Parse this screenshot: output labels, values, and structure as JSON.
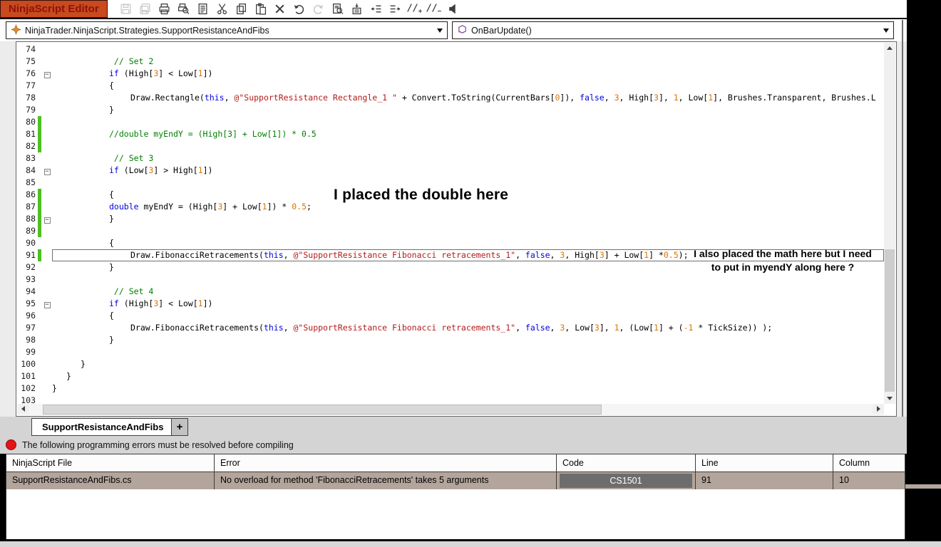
{
  "window": {
    "title": "NinjaScript Editor"
  },
  "toolbar": {
    "icons": [
      {
        "name": "save-icon",
        "disabled": true
      },
      {
        "name": "save-all-icon",
        "disabled": true
      },
      {
        "name": "print-icon",
        "disabled": false
      },
      {
        "name": "print-preview-icon",
        "disabled": false
      },
      {
        "name": "properties-icon",
        "disabled": false
      },
      {
        "name": "cut-icon",
        "disabled": false
      },
      {
        "name": "copy-icon",
        "disabled": false
      },
      {
        "name": "paste-icon",
        "disabled": false
      },
      {
        "name": "delete-icon",
        "disabled": false
      },
      {
        "name": "undo-icon",
        "disabled": false
      },
      {
        "name": "redo-icon",
        "disabled": true
      },
      {
        "name": "find-icon",
        "disabled": false
      },
      {
        "name": "code-snippet-icon",
        "disabled": false
      },
      {
        "name": "decrease-indent-icon",
        "disabled": false
      },
      {
        "name": "increase-indent-icon",
        "disabled": false
      },
      {
        "name": "add-comment-icon",
        "disabled": false
      },
      {
        "name": "remove-comment-icon",
        "disabled": false
      },
      {
        "name": "compile-icon",
        "disabled": false
      }
    ]
  },
  "navigation": {
    "class_selector": "NinjaTrader.NinjaScript.Strategies.SupportResistanceAndFibs",
    "method_selector": "OnBarUpdate()"
  },
  "editor": {
    "lines": [
      {
        "n": 74,
        "t": 0,
        "s": []
      },
      {
        "n": 75,
        "t": 4,
        "s": [
          [
            "c",
            " // Set 2"
          ]
        ]
      },
      {
        "n": 76,
        "t": 4,
        "f": true,
        "s": [
          [
            "k",
            "if"
          ],
          [
            "p",
            " (High["
          ],
          [
            "n",
            "3"
          ],
          [
            "p",
            "] < Low["
          ],
          [
            "n",
            "1"
          ],
          [
            "p",
            "])"
          ]
        ]
      },
      {
        "n": 77,
        "t": 4,
        "s": [
          [
            "p",
            "{"
          ]
        ]
      },
      {
        "n": 78,
        "t": 5.5,
        "s": [
          [
            "p",
            "Draw.Rectangle("
          ],
          [
            "k",
            "this"
          ],
          [
            "p",
            ", "
          ],
          [
            "s",
            "@\"SupportResistance Rectangle_1 \""
          ],
          [
            "p",
            " + Convert.ToString(CurrentBars["
          ],
          [
            "n",
            "0"
          ],
          [
            "p",
            "]), "
          ],
          [
            "k",
            "false"
          ],
          [
            "p",
            ", "
          ],
          [
            "n",
            "3"
          ],
          [
            "p",
            ", High["
          ],
          [
            "n",
            "3"
          ],
          [
            "p",
            "], "
          ],
          [
            "n",
            "1"
          ],
          [
            "p",
            ", Low["
          ],
          [
            "n",
            "1"
          ],
          [
            "p",
            "], Brushes.Transparent, Brushes.L"
          ]
        ]
      },
      {
        "n": 79,
        "t": 4,
        "s": [
          [
            "p",
            "}"
          ]
        ]
      },
      {
        "n": 80,
        "t": 0,
        "g": true,
        "s": []
      },
      {
        "n": 81,
        "t": 4,
        "g": true,
        "s": [
          [
            "c",
            "//double myEndY = (High[3] + Low[1]) * 0.5"
          ]
        ]
      },
      {
        "n": 82,
        "t": 0,
        "g": true,
        "s": []
      },
      {
        "n": 83,
        "t": 4,
        "s": [
          [
            "c",
            " // Set 3"
          ]
        ]
      },
      {
        "n": 84,
        "t": 4,
        "f": true,
        "s": [
          [
            "k",
            "if"
          ],
          [
            "p",
            " (Low["
          ],
          [
            "n",
            "3"
          ],
          [
            "p",
            "] > High["
          ],
          [
            "n",
            "1"
          ],
          [
            "p",
            "])"
          ]
        ]
      },
      {
        "n": 85,
        "t": 0,
        "s": []
      },
      {
        "n": 86,
        "t": 4,
        "g": true,
        "s": [
          [
            "p",
            "{"
          ]
        ]
      },
      {
        "n": 87,
        "t": 4,
        "g": true,
        "s": [
          [
            "k",
            "double"
          ],
          [
            "p",
            " myEndY = (High["
          ],
          [
            "n",
            "3"
          ],
          [
            "p",
            "] + Low["
          ],
          [
            "n",
            "1"
          ],
          [
            "p",
            "]) * "
          ],
          [
            "n",
            "0.5"
          ],
          [
            "p",
            ";"
          ]
        ]
      },
      {
        "n": 88,
        "t": 4,
        "g": true,
        "f": true,
        "s": [
          [
            "p",
            "}"
          ]
        ]
      },
      {
        "n": 89,
        "t": 0,
        "g": true,
        "s": []
      },
      {
        "n": 90,
        "t": 4,
        "s": [
          [
            "p",
            "{"
          ]
        ]
      },
      {
        "n": 91,
        "t": 5.5,
        "g": true,
        "h": true,
        "s": [
          [
            "p",
            "Draw.FibonacciRetracements("
          ],
          [
            "k",
            "this"
          ],
          [
            "p",
            ", "
          ],
          [
            "s",
            "@\"SupportResistance Fibonacci retracements_1\""
          ],
          [
            "p",
            ", "
          ],
          [
            "k",
            "false"
          ],
          [
            "p",
            ", "
          ],
          [
            "n",
            "3"
          ],
          [
            "p",
            ", High["
          ],
          [
            "n",
            "3"
          ],
          [
            "p",
            "] + Low["
          ],
          [
            "n",
            "1"
          ],
          [
            "p",
            "] *"
          ],
          [
            "n",
            "0.5"
          ],
          [
            "p",
            ");"
          ]
        ]
      },
      {
        "n": 92,
        "t": 4,
        "s": [
          [
            "p",
            "}"
          ]
        ]
      },
      {
        "n": 93,
        "t": 0,
        "s": []
      },
      {
        "n": 94,
        "t": 4,
        "s": [
          [
            "c",
            " // Set 4"
          ]
        ]
      },
      {
        "n": 95,
        "t": 4,
        "f": true,
        "s": [
          [
            "k",
            "if"
          ],
          [
            "p",
            " (High["
          ],
          [
            "n",
            "3"
          ],
          [
            "p",
            "] < Low["
          ],
          [
            "n",
            "1"
          ],
          [
            "p",
            "])"
          ]
        ]
      },
      {
        "n": 96,
        "t": 4,
        "s": [
          [
            "p",
            "{"
          ]
        ]
      },
      {
        "n": 97,
        "t": 5.5,
        "s": [
          [
            "p",
            "Draw.FibonacciRetracements("
          ],
          [
            "k",
            "this"
          ],
          [
            "p",
            ", "
          ],
          [
            "s",
            "@\"SupportResistance Fibonacci retracements_1\""
          ],
          [
            "p",
            ", "
          ],
          [
            "k",
            "false"
          ],
          [
            "p",
            ", "
          ],
          [
            "n",
            "3"
          ],
          [
            "p",
            ", Low["
          ],
          [
            "n",
            "3"
          ],
          [
            "p",
            "], "
          ],
          [
            "n",
            "1"
          ],
          [
            "p",
            ", (Low["
          ],
          [
            "n",
            "1"
          ],
          [
            "p",
            "] + ("
          ],
          [
            "n",
            "-1"
          ],
          [
            "p",
            " * TickSize)) );"
          ]
        ]
      },
      {
        "n": 98,
        "t": 4,
        "s": [
          [
            "p",
            "}"
          ]
        ]
      },
      {
        "n": 99,
        "t": 0,
        "s": []
      },
      {
        "n": 100,
        "t": 2,
        "s": [
          [
            "p",
            "}"
          ]
        ]
      },
      {
        "n": 101,
        "t": 1,
        "s": [
          [
            "p",
            "}"
          ]
        ]
      },
      {
        "n": 102,
        "t": 0,
        "s": [
          [
            "p",
            "}"
          ]
        ]
      },
      {
        "n": 103,
        "t": 0,
        "s": []
      }
    ]
  },
  "annotations": {
    "note1": "I placed the double here",
    "note2_line1": "I also placed the math here but I need",
    "note2_line2": "to put in myendY along here ?"
  },
  "tabs": {
    "active": "SupportResistanceAndFibs",
    "add_label": "+"
  },
  "error_panel": {
    "banner": "The following programming errors must be resolved before compiling",
    "columns": [
      "NinjaScript File",
      "Error",
      "Code",
      "Line",
      "Column"
    ],
    "rows": [
      {
        "file": "SupportResistanceAndFibs.cs",
        "error": "No overload for method 'FibonacciRetracements' takes 5 arguments",
        "code": "CS1501",
        "line": "91",
        "column": "10"
      }
    ]
  },
  "colors": {
    "accent_orange": "#C84A1E",
    "title_text": "#8C1409",
    "change_bar_green": "#4FBF21",
    "keyword_blue": "#0000E0",
    "string_red": "#B41A1A",
    "number_orange": "#DE7300",
    "comment_green": "#027F00",
    "error_red": "#E21414",
    "error_row_tan": "#B3A59B",
    "code_badge_gray": "#6D6D6D"
  }
}
